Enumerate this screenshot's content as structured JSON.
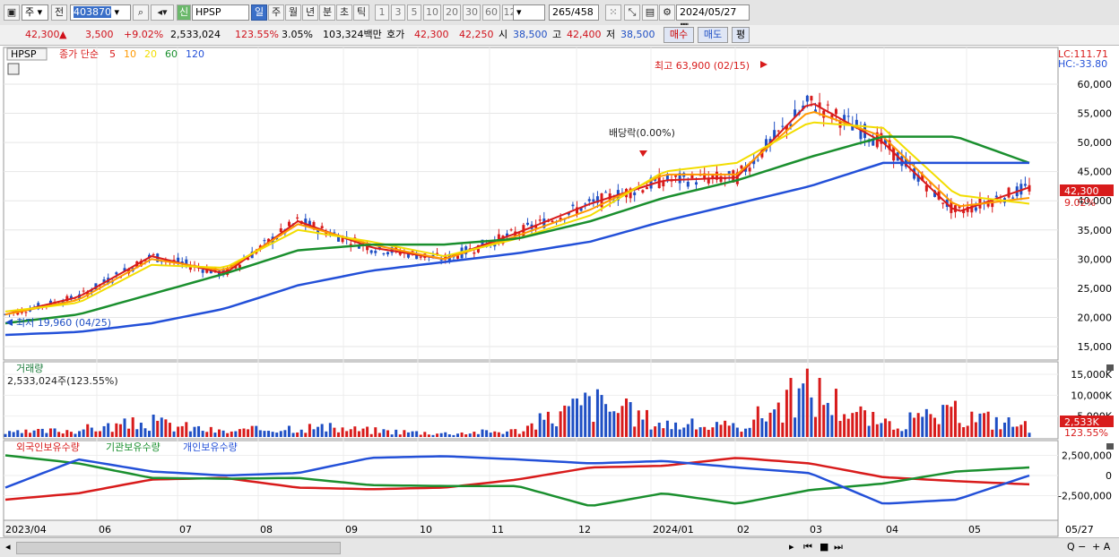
{
  "toolbar": {
    "period_label": "주",
    "prev_label": "전",
    "code": "403870",
    "new_badge": "신",
    "name": "HPSP",
    "intervals": [
      "일",
      "주",
      "월",
      "년",
      "분",
      "초",
      "틱"
    ],
    "active_interval": "일",
    "counts": [
      "1",
      "3",
      "5",
      "10",
      "20",
      "30",
      "60",
      "120"
    ],
    "count_value": "265",
    "count_total": "/458",
    "date": "2024/05/27"
  },
  "quote": {
    "price": "42,300",
    "change": "3,500",
    "change_pct": "+9.02%",
    "volume": "2,533,024",
    "vol_ratio": "123.55%",
    "turnover": "3.05%",
    "amount": "103,324백만",
    "bid_label": "호가",
    "bid1": "42,300",
    "bid2": "42,250",
    "open_label": "시",
    "open": "38,500",
    "high_label": "고",
    "high": "42,400",
    "low_label": "저",
    "low": "38,500",
    "buy_label": "매수",
    "sell_label": "매도",
    "eval_label": "평"
  },
  "legend": {
    "symbol": "HPSP",
    "ma_title": "종가 단순",
    "ma_periods": [
      "5",
      "10",
      "20",
      "60",
      "120"
    ],
    "ma_colors": [
      "#d81b1b",
      "#ff9900",
      "#f2dd00",
      "#1a8f2e",
      "#2350d8"
    ],
    "lc": "LC:111.71",
    "hc": "HC:-33.80"
  },
  "annotations": {
    "max_label": "최고 63,900 (02/15)",
    "min_label": "최저 19,960 (04/25)",
    "dividend_label": "배당락(0.00%)",
    "last_price": "42,300",
    "last_pct": "9.02%"
  },
  "volume_panel": {
    "title": "거래량",
    "info": "2,533,024주(123.55%)",
    "last_value": "2,533K",
    "last_pct": "123.55%",
    "ticks": [
      "15,000K",
      "10,000K",
      "5,000K"
    ]
  },
  "holding_panel": {
    "legends": [
      "외국인보유수량",
      "기관보유수량",
      "개인보유수량"
    ],
    "ticks": [
      "2,500,000",
      "0",
      "-2,500,000"
    ]
  },
  "x_axis": {
    "labels": [
      "2023/04",
      "06",
      "07",
      "08",
      "09",
      "10",
      "11",
      "12",
      "2024/01",
      "02",
      "03",
      "04",
      "05",
      "05/27"
    ]
  },
  "chart_data": {
    "type": "line",
    "title": "HPSP",
    "ylim": [
      15000,
      65000
    ],
    "y_ticks": [
      15000,
      20000,
      25000,
      30000,
      35000,
      40000,
      45000,
      50000,
      55000,
      60000
    ],
    "x": [
      "2023/04",
      "05",
      "06",
      "07",
      "08",
      "09",
      "10",
      "11",
      "12",
      "2024/01",
      "02",
      "03",
      "04",
      "05",
      "05/27"
    ],
    "series": [
      {
        "name": "5",
        "values": [
          20500,
          23500,
          30500,
          27500,
          36500,
          32000,
          30000,
          34500,
          39500,
          43500,
          44000,
          57000,
          50000,
          38000,
          42300
        ]
      },
      {
        "name": "10",
        "values": [
          20500,
          23000,
          30000,
          28000,
          36000,
          32500,
          30000,
          34000,
          38500,
          44500,
          44500,
          55500,
          51000,
          39000,
          40500
        ]
      },
      {
        "name": "20",
        "values": [
          21000,
          22500,
          29000,
          28500,
          35000,
          33000,
          30500,
          33500,
          37500,
          45000,
          46500,
          53500,
          52500,
          41000,
          39500
        ]
      },
      {
        "name": "60",
        "values": [
          19000,
          20500,
          24000,
          27500,
          31500,
          32500,
          32500,
          33500,
          36500,
          40500,
          43500,
          47500,
          51000,
          51000,
          46500
        ]
      },
      {
        "name": "120",
        "values": [
          17000,
          17500,
          19000,
          21500,
          25500,
          28000,
          29500,
          31000,
          33000,
          36500,
          39500,
          42500,
          46500,
          46500,
          46500
        ]
      }
    ],
    "volume_k": [
      900,
      1800,
      3500,
      1200,
      2500,
      1600,
      900,
      1500,
      8500,
      3200,
      2300,
      11500,
      2800,
      5600,
      2533
    ],
    "holdings": [
      {
        "name": "외국인보유수량",
        "values": [
          -3000000,
          -2200000,
          -500000,
          -300000,
          -1500000,
          -1700000,
          -1500000,
          -500000,
          1000000,
          1200000,
          2200000,
          1500000,
          -200000,
          -700000,
          -1100000
        ]
      },
      {
        "name": "기관보유수량",
        "values": [
          2500000,
          1500000,
          -300000,
          -400000,
          -300000,
          -1200000,
          -1300000,
          -1300000,
          -3800000,
          -2200000,
          -3500000,
          -1800000,
          -1000000,
          500000,
          1000000
        ]
      },
      {
        "name": "개인보유수량",
        "values": [
          -1500000,
          2000000,
          500000,
          0,
          300000,
          2200000,
          2400000,
          2000000,
          1500000,
          1800000,
          1000000,
          300000,
          -3500000,
          -3000000,
          0
        ]
      }
    ]
  }
}
